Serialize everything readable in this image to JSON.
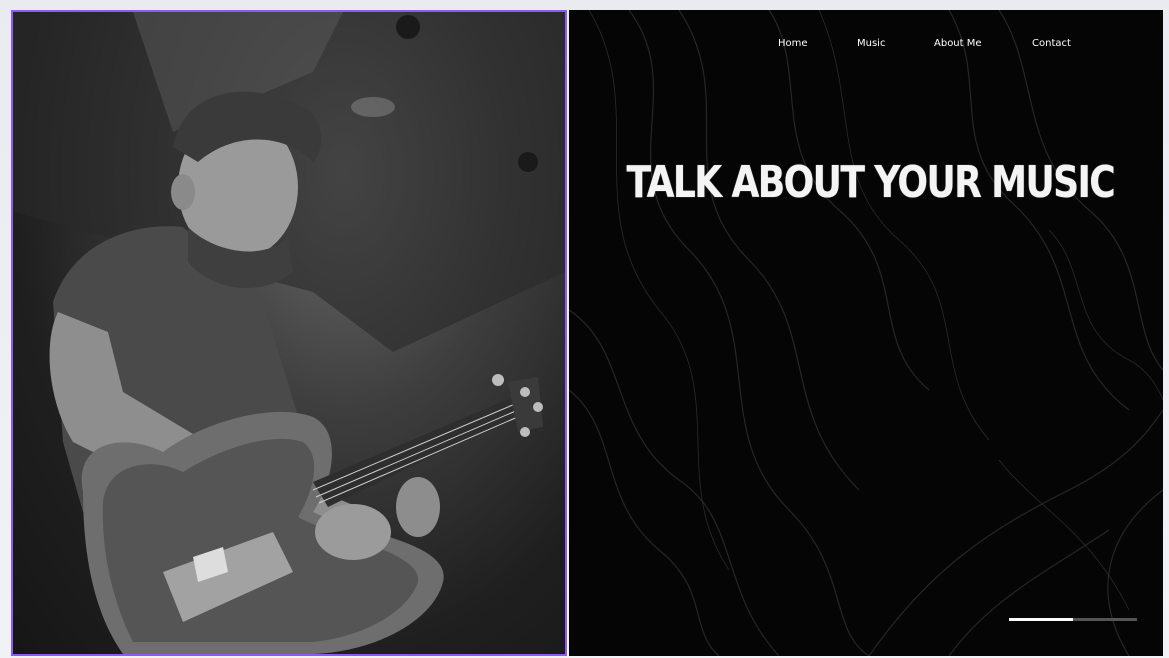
{
  "nav": {
    "items": [
      {
        "label": "Home"
      },
      {
        "label": "Music"
      },
      {
        "label": "About Me"
      },
      {
        "label": "Contact"
      }
    ]
  },
  "hero": {
    "headline": "TALK ABOUT YOUR MUSIC"
  },
  "slider": {
    "progress": 0.5
  },
  "colors": {
    "accent_border": "#8a5cf5",
    "hero_background": "#050505",
    "text": "#ffffff"
  },
  "photo": {
    "subject": "guitarist-photo"
  }
}
